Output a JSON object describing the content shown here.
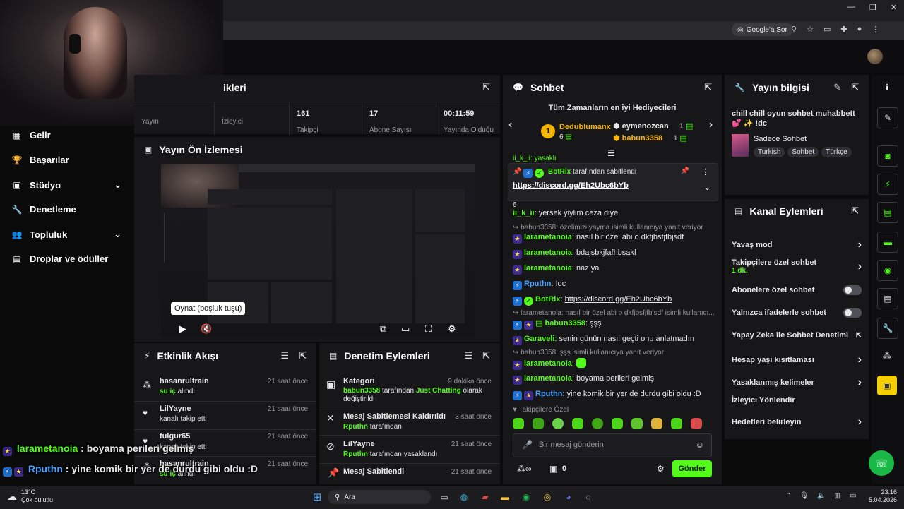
{
  "browser": {
    "google_ask": "Google'a Sor"
  },
  "stats": {
    "title_partial": "ikleri",
    "items": [
      {
        "value": "",
        "label": "Yayın"
      },
      {
        "value": "",
        "label": "İzleyici"
      },
      {
        "value": "161",
        "label": "Takipçi"
      },
      {
        "value": "17",
        "label": "Abone Sayısı"
      },
      {
        "value": "00:11:59",
        "label": "Yayında Olduğu"
      }
    ]
  },
  "sidebar": {
    "items": [
      {
        "label": "Gelir",
        "icon": "revenue-icon"
      },
      {
        "label": "Başarılar",
        "icon": "trophy-icon"
      },
      {
        "label": "Stüdyo",
        "icon": "studio-icon",
        "expandable": true
      },
      {
        "label": "Denetleme",
        "icon": "wrench-icon"
      },
      {
        "label": "Topluluk",
        "icon": "community-icon",
        "expandable": true
      },
      {
        "label": "Droplar ve ödüller",
        "icon": "drops-icon"
      }
    ]
  },
  "preview": {
    "title": "Yayın Ön İzlemesi",
    "tooltip": "Oynat (boşluk tuşu)"
  },
  "activity": {
    "title": "Etkinlik Akışı",
    "items": [
      {
        "user": "hasanrultrain",
        "highlight": "su iç",
        "rest": " alındı",
        "time": "21 saat önce",
        "icon": "drop-icon"
      },
      {
        "user": "LilYayne",
        "highlight": "",
        "rest": "kanalı takip etti",
        "time": "21 saat önce",
        "icon": "heart-icon"
      },
      {
        "user": "fulgur65",
        "highlight": "",
        "rest": "kanalı takip etti",
        "time": "21 saat önce",
        "icon": "heart-icon"
      },
      {
        "user": "hasanrultrain",
        "highlight": "su iç",
        "rest": " alındı",
        "time": "21 saat önce",
        "icon": "drop-icon"
      }
    ]
  },
  "moderation": {
    "title": "Denetim Eylemleri",
    "items": [
      {
        "title": "Kategori",
        "time": "9 dakika önce",
        "actor": "babun3358",
        "mid": " tarafından ",
        "target": "Just Chatting",
        "tail": " olarak değiştirildi",
        "icon": "category-icon"
      },
      {
        "title": "Mesaj Sabitlemesi Kaldırıldı",
        "time": "3 saat önce",
        "actor": "Rputhn",
        "mid": " tarafından",
        "target": "",
        "tail": "",
        "icon": "unpin-icon"
      },
      {
        "title": "LilYayne",
        "time": "21 saat önce",
        "actor": "Rputhn",
        "mid": " tarafından yasaklandı",
        "target": "",
        "tail": "",
        "icon": "ban-icon"
      },
      {
        "title": "Mesaj Sabitlendi",
        "time": "21 saat önce",
        "actor": "",
        "mid": "",
        "target": "",
        "tail": "",
        "icon": "pin-icon"
      }
    ]
  },
  "chat": {
    "title": "Sohbet",
    "gifters_title": "Tüm Zamanların en iyi Hediyecileri",
    "gifters": [
      {
        "rank": "1",
        "name": "Dedublumanx",
        "count": "6"
      },
      {
        "rank": "",
        "name": "eymenozcan",
        "count": "1"
      },
      {
        "rank": "",
        "name": "babun3358",
        "count": "1"
      }
    ],
    "pinned_by": "BotRix",
    "pinned_text": " tarafından sabitlendi",
    "pinned_link": "https://discord.gg/Eh2Ubc6bYb",
    "partial_line": "ii_k_ii: yasaklı",
    "partial_line2": "6",
    "messages": [
      {
        "user": "ii_k_ii",
        "text": ": yersek yiylim ceza diye",
        "color": "#53fc18",
        "reply": ""
      },
      {
        "user": "",
        "text": "",
        "color": "",
        "reply": "babun3358: özelimizi yayma isimli kullanıcıya yanıt veriyor"
      },
      {
        "user": "larametanoia",
        "text": ": nasıl bir özel abi o dkfjbsfjfbjsdf",
        "color": "#53fc18",
        "reply": ""
      },
      {
        "user": "larametanoia",
        "text": ": bdajsbkjfafhbsakf",
        "color": "#53fc18",
        "reply": ""
      },
      {
        "user": "larametanoia",
        "text": ": naz ya",
        "color": "#53fc18",
        "reply": ""
      },
      {
        "user": "Rputhn",
        "text": ": !dc",
        "color": "#4aa3ff",
        "reply": ""
      },
      {
        "user": "BotRix",
        "text": ": ",
        "link": "https://discord.gg/Eh2Ubc6bYb",
        "color": "#53fc18",
        "reply": ""
      },
      {
        "user": "",
        "text": "",
        "color": "",
        "reply": "larametanoia: nasıl bir özel abi o dkfjbsfjfbjsdf isimli kullanıcı..."
      },
      {
        "user": "babun3358",
        "text": ": şşş",
        "color": "#53fc18",
        "reply": ""
      },
      {
        "user": "Garaveli",
        "text": ": senin günün nasıl geçti onu anlatmadın",
        "color": "#53fc18",
        "reply": ""
      },
      {
        "user": "",
        "text": "",
        "color": "",
        "reply": "babun3358: şşş isimli kullanıcıya yanıt veriyor"
      },
      {
        "user": "larametanoia",
        "text": ":",
        "color": "#53fc18",
        "reply": ""
      },
      {
        "user": "larametanoia",
        "text": ": boyama perileri gelmiş",
        "color": "#53fc18",
        "reply": ""
      },
      {
        "user": "Rputhn",
        "text": ": yine komik bir yer de durdu gibi oldu :D",
        "color": "#4aa3ff",
        "reply": ""
      }
    ],
    "followers_only": "Takipçilere Özel",
    "input_placeholder": "Bir mesaj gönderin",
    "send": "Gönder",
    "points": "0"
  },
  "stream_info": {
    "title": "Yayın bilgisi",
    "stream_title": "chill chill oyun sohbet muhabbett 💕 ✨ !dc",
    "category": "Sadece Sohbet",
    "tags": [
      "Turkish",
      "Sohbet",
      "Türkçe"
    ]
  },
  "channel_actions": {
    "title": "Kanal Eylemleri",
    "items": [
      {
        "label": "Yavaş mod",
        "sub": "",
        "control": "chevron"
      },
      {
        "label": "Takipçilere özel sohbet",
        "sub": "1 dk.",
        "control": "chevron"
      },
      {
        "label": "Abonelere özel sohbet",
        "sub": "",
        "control": "toggle"
      },
      {
        "label": "Yalnızca ifadelerle sohbet",
        "sub": "",
        "control": "toggle"
      },
      {
        "label": "Yapay Zeka ile Sohbet Denetimi",
        "sub": "",
        "control": "external"
      },
      {
        "label": "Hesap yaşı kısıtlaması",
        "sub": "",
        "control": "chevron"
      },
      {
        "label": "Yasaklanmış kelimeler",
        "sub": "",
        "control": "chevron"
      },
      {
        "label": "İzleyici Yönlendir",
        "sub": "",
        "control": "none"
      },
      {
        "label": "Hedefleri belirleyin",
        "sub": "",
        "control": "chevron"
      }
    ]
  },
  "overlay_chat": [
    {
      "user": "larametanoia",
      "text": " : boyama perileri gelmiş",
      "color": "#53fc18"
    },
    {
      "user": "Rputhn",
      "text": " : yine komik bir yer de durdu gibi oldu :D",
      "color": "#4aa3ff"
    }
  ],
  "taskbar": {
    "weather_temp": "13°C",
    "weather_desc": "Çok bulutlu",
    "search": "Ara",
    "time": "23:16",
    "date": "5.04.2026"
  }
}
